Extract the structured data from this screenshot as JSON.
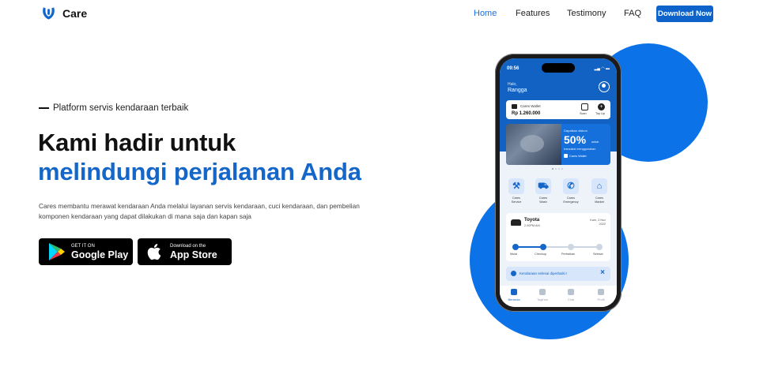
{
  "brand": {
    "name": "Care",
    "color": "#1466c9"
  },
  "nav": {
    "links": [
      "Home",
      "Features",
      "Testimony",
      "FAQ"
    ],
    "active": "Home",
    "cta": "Download Now"
  },
  "hero": {
    "tagline": "Platform servis kendaraan terbaik",
    "title_line1": "Kami hadir untuk",
    "title_line2": "melindungi perjalanan Anda",
    "description": "Cares membantu merawat kendaraan Anda melalui layanan servis kendaraan, cuci kendaraan, dan pembelian komponen kendaraan yang dapat dilakukan di mana saja dan kapan saja",
    "google_play": {
      "small": "GET IT ON",
      "big": "Google Play"
    },
    "app_store": {
      "small": "Download on the",
      "big": "App Store"
    }
  },
  "phone": {
    "time": "09:56",
    "status_icons": "▂▄ ◠ ▬",
    "greeting": "Halo,",
    "user": "Rangga",
    "wallet": {
      "label": "Cares Wallet",
      "amount": "Rp 1.260.000",
      "scan": "Scan",
      "topup": "Top Up"
    },
    "promo": {
      "small": "Dapatkan diskon",
      "big": "50%",
      "untuk": "untuk",
      "sub": "transaksi menggunakan",
      "wallet": "Cares Wallet"
    },
    "services": [
      {
        "icon": "⚒",
        "label1": "Cares",
        "label2": "Service"
      },
      {
        "icon": "⛟",
        "label1": "Cares",
        "label2": "Wash"
      },
      {
        "icon": "✆",
        "label1": "Cares",
        "label2": "Emergency"
      },
      {
        "icon": "⌂",
        "label1": "Cares",
        "label2": "Market"
      }
    ],
    "order": {
      "name": "Toyota",
      "time": "2.00PM AM",
      "date1": "Kam, 3 Nov",
      "date2": "2022",
      "steps": [
        "Mulai",
        "Checkup",
        "Perbaikan",
        "Selesai"
      ],
      "completed_steps": 2
    },
    "notice": "Kendaraan selesai diperbaiki !",
    "tabs": [
      "Beranda",
      "Tagihan",
      "Chat",
      "Profil"
    ],
    "active_tab": "Beranda"
  },
  "colors": {
    "accent": "#0b72e8",
    "button_dark": "#000000",
    "cta": "#0d63c9"
  }
}
